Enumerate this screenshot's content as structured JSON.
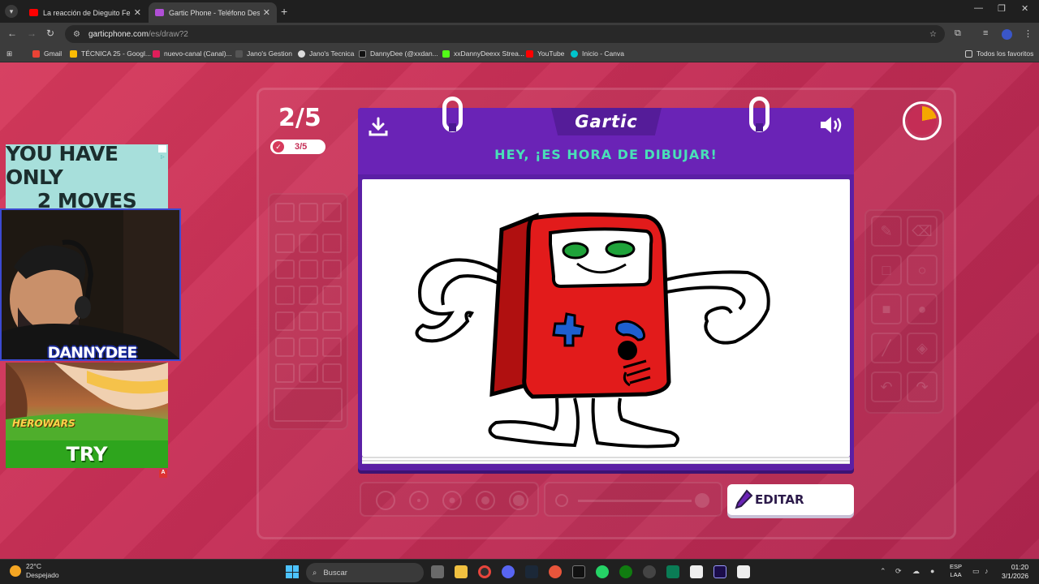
{
  "browser": {
    "tabs": [
      {
        "title": "La reacción de Dieguito Fernan",
        "favicon_color": "#ff0000"
      },
      {
        "title": "Gartic Phone - Teléfono Descon",
        "favicon_color": "#b04fd6"
      }
    ],
    "url_host": "garticphone.com",
    "url_path": "/es/draw?2",
    "bookmarks": [
      {
        "label": "Gmail",
        "color": "#ea4335"
      },
      {
        "label": "TÉCNICA 25 - Googl...",
        "color": "#fbbc04"
      },
      {
        "label": "nuevo-canal (Canal)...",
        "color": "#e01e5a"
      },
      {
        "label": "Jano's Gestion",
        "color": "#555555"
      },
      {
        "label": "Jano's Tecnica",
        "color": "#dddddd"
      },
      {
        "label": "DannyDee (@xxdan...",
        "color": "#111111"
      },
      {
        "label": "xxDannyDeexx Strea...",
        "color": "#53fc18"
      },
      {
        "label": "YouTube",
        "color": "#ff0000"
      },
      {
        "label": "Inicio - Canva",
        "color": "#00c4cc"
      }
    ],
    "all_bookmarks": "Todos los favoritos"
  },
  "game": {
    "round": "2/5",
    "round_badge": "3/5",
    "logo": "Gartic",
    "headline": "HEY, ¡ES HORA DE DIBUJAR!",
    "edit_label": "EDITAR",
    "timer_progress": 0.22,
    "colors": {
      "accent": "#6a23b6",
      "headline": "#49e0b8",
      "bg": "#d63a5c"
    }
  },
  "ads": {
    "top_text": [
      "YOU HAVE ONLY",
      "2 MOVES"
    ],
    "bottom_brand": "HEROWARS",
    "bottom_cta": "TRY"
  },
  "stream": {
    "cam_label": "DANNYDEE"
  },
  "taskbar": {
    "temperature": "22°C",
    "weather": "Despejado",
    "search_placeholder": "Buscar",
    "lang_top": "ESP",
    "lang_bottom": "LAA",
    "time": "01:20",
    "date": "3/1/2026"
  }
}
